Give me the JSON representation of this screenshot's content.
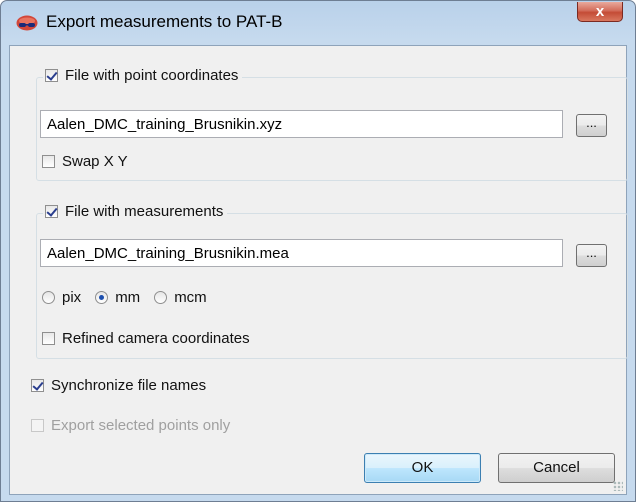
{
  "window": {
    "title": "Export measurements to PAT-B",
    "close_label": "x"
  },
  "group_points": {
    "checkbox_label": "File with point coordinates",
    "checked": true,
    "file_value": "Aalen_DMC_training_Brusnikin.xyz",
    "browse_label": "...",
    "swap_label": "Swap X Y",
    "swap_checked": false
  },
  "group_measurements": {
    "checkbox_label": "File with measurements",
    "checked": true,
    "file_value": "Aalen_DMC_training_Brusnikin.mea",
    "browse_label": "...",
    "units": [
      {
        "label": "pix",
        "selected": false
      },
      {
        "label": "mm",
        "selected": true
      },
      {
        "label": "mcm",
        "selected": false
      }
    ],
    "refined_label": "Refined camera coordinates",
    "refined_checked": false
  },
  "options": {
    "sync_label": "Synchronize file names",
    "sync_checked": true,
    "selected_only_label": "Export selected points only",
    "selected_only_checked": false,
    "selected_only_enabled": false
  },
  "buttons": {
    "ok_label": "OK",
    "cancel_label": "Cancel"
  },
  "colors": {
    "title_bar": "#c6daee",
    "close_button": "#c44c36",
    "client_bg": "#f0f0f0",
    "check_mark": "#2a3e8e",
    "default_button_border": "#3c7fb1"
  }
}
